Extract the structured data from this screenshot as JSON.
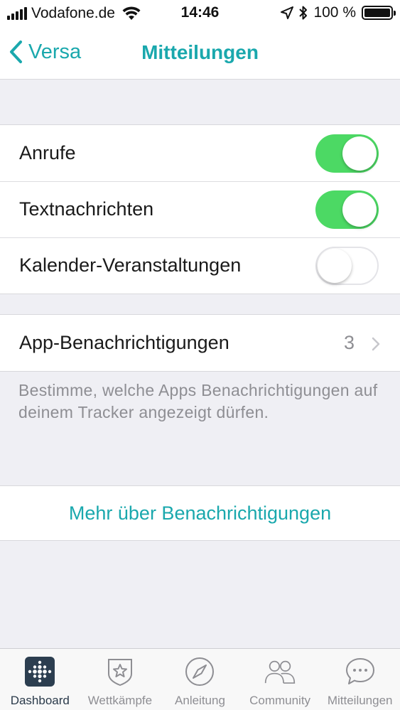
{
  "status_bar": {
    "carrier": "Vodafone.de",
    "time": "14:46",
    "battery": "100 %"
  },
  "nav": {
    "back_label": "Versa",
    "title": "Mitteilungen"
  },
  "toggles": [
    {
      "label": "Anrufe",
      "on": true
    },
    {
      "label": "Textnachrichten",
      "on": true
    },
    {
      "label": "Kalender-Veranstaltungen",
      "on": false
    }
  ],
  "app_notifications": {
    "label": "App-Benachrichtigungen",
    "count": "3"
  },
  "footnote": "Bestimme, welche Apps Benachrichtigungen auf deinem Tracker angezeigt dürfen.",
  "more_link": "Mehr über Benachrichtigungen",
  "tabs": [
    {
      "label": "Dashboard",
      "icon": "dashboard-icon",
      "active": true
    },
    {
      "label": "Wettkämpfe",
      "icon": "challenges-star-icon",
      "active": false
    },
    {
      "label": "Anleitung",
      "icon": "compass-icon",
      "active": false
    },
    {
      "label": "Community",
      "icon": "community-people-icon",
      "active": false
    },
    {
      "label": "Mitteilungen",
      "icon": "chat-bubble-icon",
      "active": false
    }
  ],
  "colors": {
    "accent": "#1aa8ad",
    "toggle_on": "#4cd964",
    "background": "#efeff4"
  }
}
